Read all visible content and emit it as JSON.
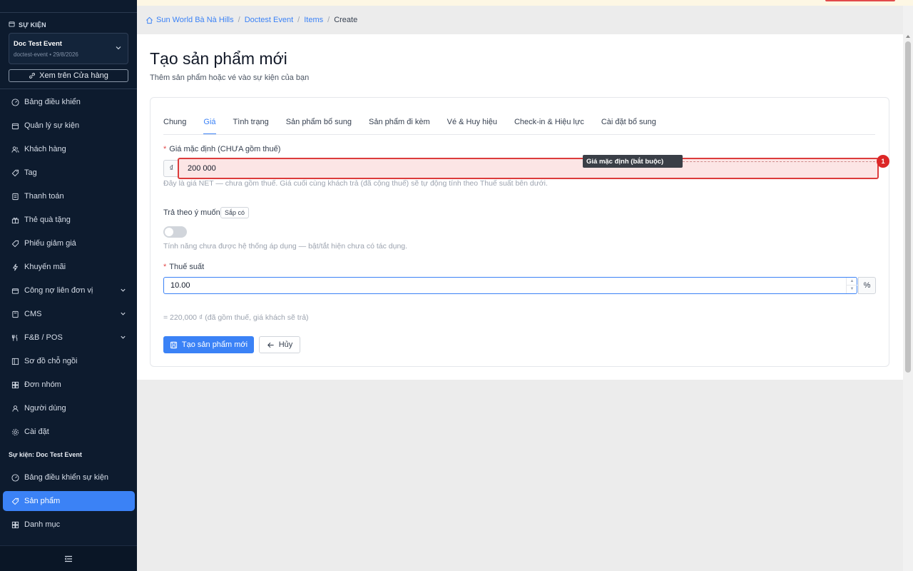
{
  "sidebar": {
    "section_title": "SỰ KIỆN",
    "event": {
      "name": "Doc Test Event",
      "slug_date": "doctest-event • 29/8/2026"
    },
    "shop_button": "Xem trên Cửa hàng",
    "items": [
      {
        "label": "Bảng điều khiển",
        "icon": "dashboard-icon"
      },
      {
        "label": "Quản lý sự kiện",
        "icon": "calendar-icon"
      },
      {
        "label": "Khách hàng",
        "icon": "users-icon"
      },
      {
        "label": "Tag",
        "icon": "tag-icon"
      },
      {
        "label": "Thanh toán",
        "icon": "receipt-icon"
      },
      {
        "label": "Thẻ quà tặng",
        "icon": "gift-icon"
      },
      {
        "label": "Phiếu giảm giá",
        "icon": "ticket-icon"
      },
      {
        "label": "Khuyến mãi",
        "icon": "bolt-icon"
      },
      {
        "label": "Công nợ liên đơn vị",
        "icon": "wallet-icon"
      },
      {
        "label": "CMS",
        "icon": "document-icon"
      },
      {
        "label": "F&B / POS",
        "icon": "food-icon"
      },
      {
        "label": "Sơ đồ chỗ ngồi",
        "icon": "seatmap-icon"
      },
      {
        "label": "Đơn nhóm",
        "icon": "grid-icon"
      },
      {
        "label": "Người dùng",
        "icon": "user-icon"
      },
      {
        "label": "Cài đặt",
        "icon": "gear-icon"
      }
    ],
    "event_group_title": "Sự kiện: Doc Test Event",
    "event_items": [
      {
        "label": "Bảng điều khiển sự kiện",
        "icon": "dashboard-icon"
      },
      {
        "label": "Sản phẩm",
        "icon": "tag-icon",
        "active": true
      },
      {
        "label": "Danh mục",
        "icon": "grid-icon"
      }
    ]
  },
  "breadcrumb": {
    "home": "Sun World Bà Nà Hills",
    "event": "Doctest Event",
    "items": "Items",
    "current": "Create"
  },
  "page": {
    "title": "Tạo sản phẩm mới",
    "subtitle": "Thêm sản phẩm hoặc vé vào sự kiện của bạn"
  },
  "tabs": [
    "Chung",
    "Giá",
    "Tình trạng",
    "Sản phẩm bổ sung",
    "Sản phẩm đi kèm",
    "Vé & Huy hiệu",
    "Check-in & Hiệu lực",
    "Cài đặt bổ sung"
  ],
  "active_tab": "Giá",
  "form": {
    "price_label": "Giá mặc định (CHƯA gồm thuế)",
    "currency_symbol": "₫",
    "price_value": "200 000",
    "price_tooltip": "Giá mặc định (bắt buộc)",
    "badge_number": "1",
    "price_help": "Đây là giá NET — chưa gồm thuế. Giá cuối cùng khách trả (đã cộng thuế) sẽ tự động tính theo Thuế suất bên dưới.",
    "pay_what_label": "Trả theo ý muốn",
    "soon_badge": "Sắp có",
    "toggle_on": false,
    "toggle_help": "Tính năng chưa được hệ thống áp dụng — bật/tắt hiện chưa có tác dụng.",
    "tax_label": "Thuế suất",
    "tax_value": "10.00",
    "tax_suffix": "%",
    "total_note": "= 220,000 ₫ (đã gồm thuế, giá khách sẽ trả)",
    "submit_label": "Tạo sản phẩm mới",
    "cancel_label": "Hủy"
  },
  "colors": {
    "sidebar_bg": "#0d1b2e",
    "accent": "#3b82f6",
    "error": "#dc3c3c"
  }
}
